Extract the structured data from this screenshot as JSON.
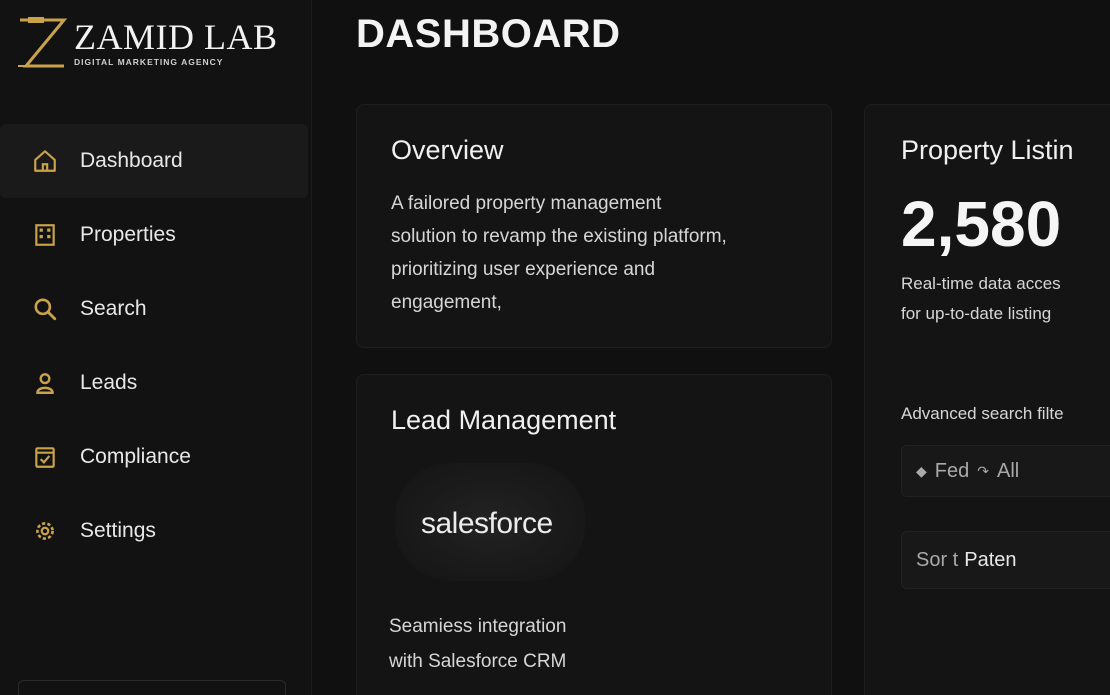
{
  "brand": {
    "name": "ZAMID LAB",
    "tagline": "DIGITAL MARKETING AGENCY",
    "accent": "#c9a24a"
  },
  "page_title": "DASHBOARD",
  "sidebar": {
    "items": [
      {
        "label": "Dashboard",
        "icon": "home-icon",
        "active": true
      },
      {
        "label": "Properties",
        "icon": "building-icon",
        "active": false
      },
      {
        "label": "Search",
        "icon": "search-icon",
        "active": false
      },
      {
        "label": "Leads",
        "icon": "user-icon",
        "active": false
      },
      {
        "label": "Compliance",
        "icon": "checklist-icon",
        "active": false
      },
      {
        "label": "Settings",
        "icon": "gear-icon",
        "active": false
      }
    ]
  },
  "overview": {
    "title": "Overview",
    "lines": [
      "A failored property management",
      "solution to revamp the existing platform,",
      "prioritizing user experience and",
      "engagement,"
    ]
  },
  "lead_management": {
    "title": "Lead Management",
    "logo_text": "salesforce",
    "lines": [
      "Seamiess integration",
      "with Salesforce CRM"
    ]
  },
  "property_listing": {
    "title": "Property Listin",
    "count": "2,580",
    "lines": [
      "Real-time data acces",
      "for up-to-date listing"
    ],
    "filters_label": "Advanced search filte",
    "filter_chips": [
      "Fed",
      "All"
    ],
    "sort_prefix": "Sor t",
    "sort_value": "Paten"
  }
}
